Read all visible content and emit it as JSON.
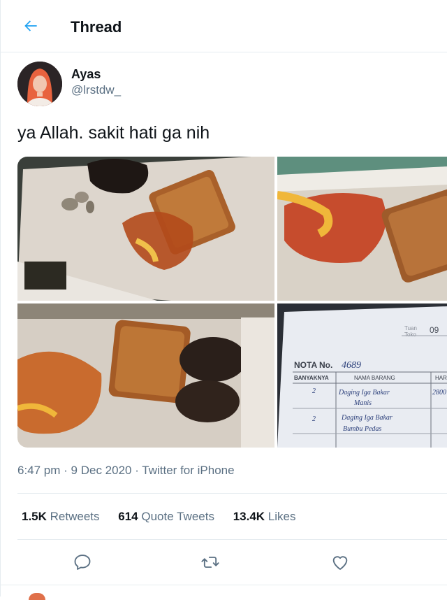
{
  "colors": {
    "accent": "#1da1f2",
    "secondary_text": "#5b7083",
    "primary_text": "#0f1419",
    "divider": "#e6ecf0"
  },
  "header": {
    "back_icon": "arrow-left-icon",
    "title": "Thread"
  },
  "tweet": {
    "author_name": "Ayas",
    "author_handle": "@lrstdw_",
    "text": "ya Allah. sakit hati ga nih",
    "timestamp": "6:47 pm · 9 Dec 2020 · Twitter for iPhone",
    "receipt": {
      "toko_label": "Tuan",
      "toko_label2": "Toko",
      "date_fragment": "09",
      "nota_label": "NOTA No.",
      "nota_number": "4689",
      "col_qty": "BANYAKNYA",
      "col_name": "NAMA BARANG",
      "col_price": "HARGA",
      "row1_qty": "2",
      "row1_item": "Daging Iga Bakar",
      "row1_item2": "Manis",
      "row1_price": "2800",
      "row2_qty": "2",
      "row2_item": "Daging Iga Bakar",
      "row2_item2": "Bumbu Pedas"
    }
  },
  "stats": [
    {
      "count": "1.5K",
      "label": "Retweets"
    },
    {
      "count": "614",
      "label": "Quote Tweets"
    },
    {
      "count": "13.4K",
      "label": "Likes"
    }
  ],
  "actions": [
    "reply-icon",
    "retweet-icon",
    "like-icon"
  ]
}
